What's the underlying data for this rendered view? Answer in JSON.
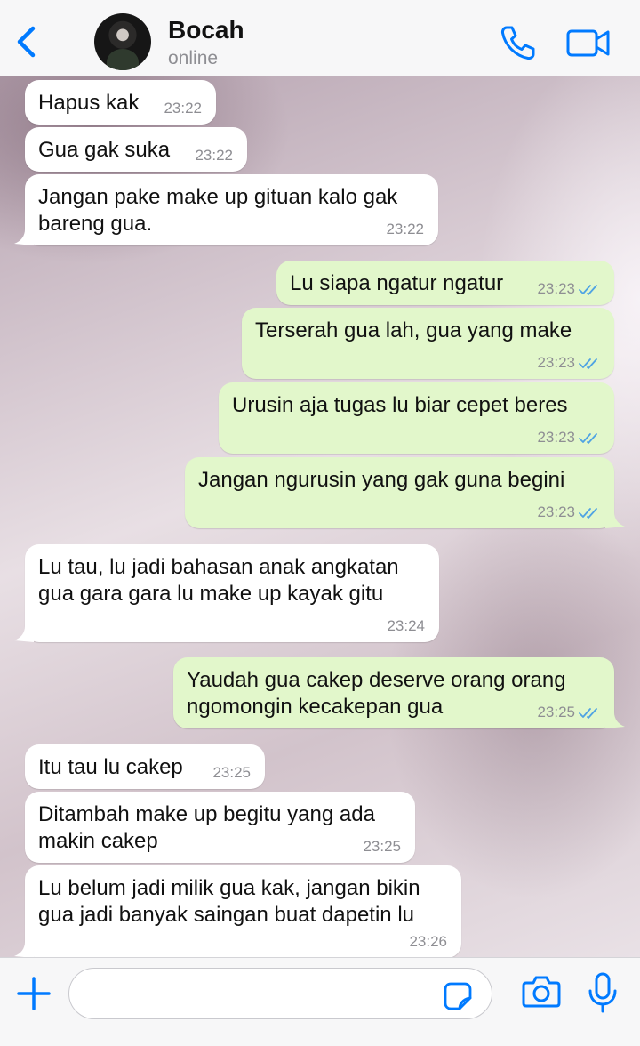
{
  "colors": {
    "accent": "#007aff",
    "incoming_bubble": "#ffffff",
    "outgoing_bubble": "#e2f7cb",
    "read_ticks": "#4fa3e3"
  },
  "header": {
    "back_icon": "chevron-left-icon",
    "contact_name": "Bocah",
    "status": "online",
    "call_icon": "phone-icon",
    "video_icon": "video-camera-icon"
  },
  "messages": [
    {
      "dir": "in",
      "text": "Hapus kak",
      "time": "23:22"
    },
    {
      "dir": "in",
      "text": "Gua gak suka",
      "time": "23:22"
    },
    {
      "dir": "in",
      "text": "Jangan pake make up gituan kalo gak\nbareng gua.",
      "time": "23:22"
    },
    {
      "dir": "out",
      "text": "Lu siapa ngatur ngatur",
      "time": "23:23",
      "read": true
    },
    {
      "dir": "out",
      "text": "Terserah gua lah, gua yang make",
      "time": "23:23",
      "read": true
    },
    {
      "dir": "out",
      "text": "Urusin aja tugas lu biar cepet beres",
      "time": "23:23",
      "read": true
    },
    {
      "dir": "out",
      "text": "Jangan ngurusin yang gak guna begini",
      "time": "23:23",
      "read": true
    },
    {
      "dir": "in",
      "text": "Lu tau, lu jadi bahasan anak angkatan\ngua gara gara lu make up kayak gitu",
      "time": "23:24"
    },
    {
      "dir": "out",
      "text": "Yaudah gua cakep deserve orang orang\nngomongin kecakepan gua",
      "time": "23:25",
      "read": true
    },
    {
      "dir": "in",
      "text": "Itu tau lu cakep",
      "time": "23:25"
    },
    {
      "dir": "in",
      "text": "Ditambah make up begitu yang ada\nmakin cakep",
      "time": "23:25"
    },
    {
      "dir": "in",
      "text": "Lu belum jadi milik gua kak, jangan bikin\ngua jadi banyak saingan buat dapetin lu",
      "time": "23:26"
    }
  ],
  "input_bar": {
    "plus_icon": "plus-icon",
    "message_value": "",
    "sticker_icon": "sticker-icon",
    "camera_icon": "camera-icon",
    "mic_icon": "microphone-icon"
  }
}
